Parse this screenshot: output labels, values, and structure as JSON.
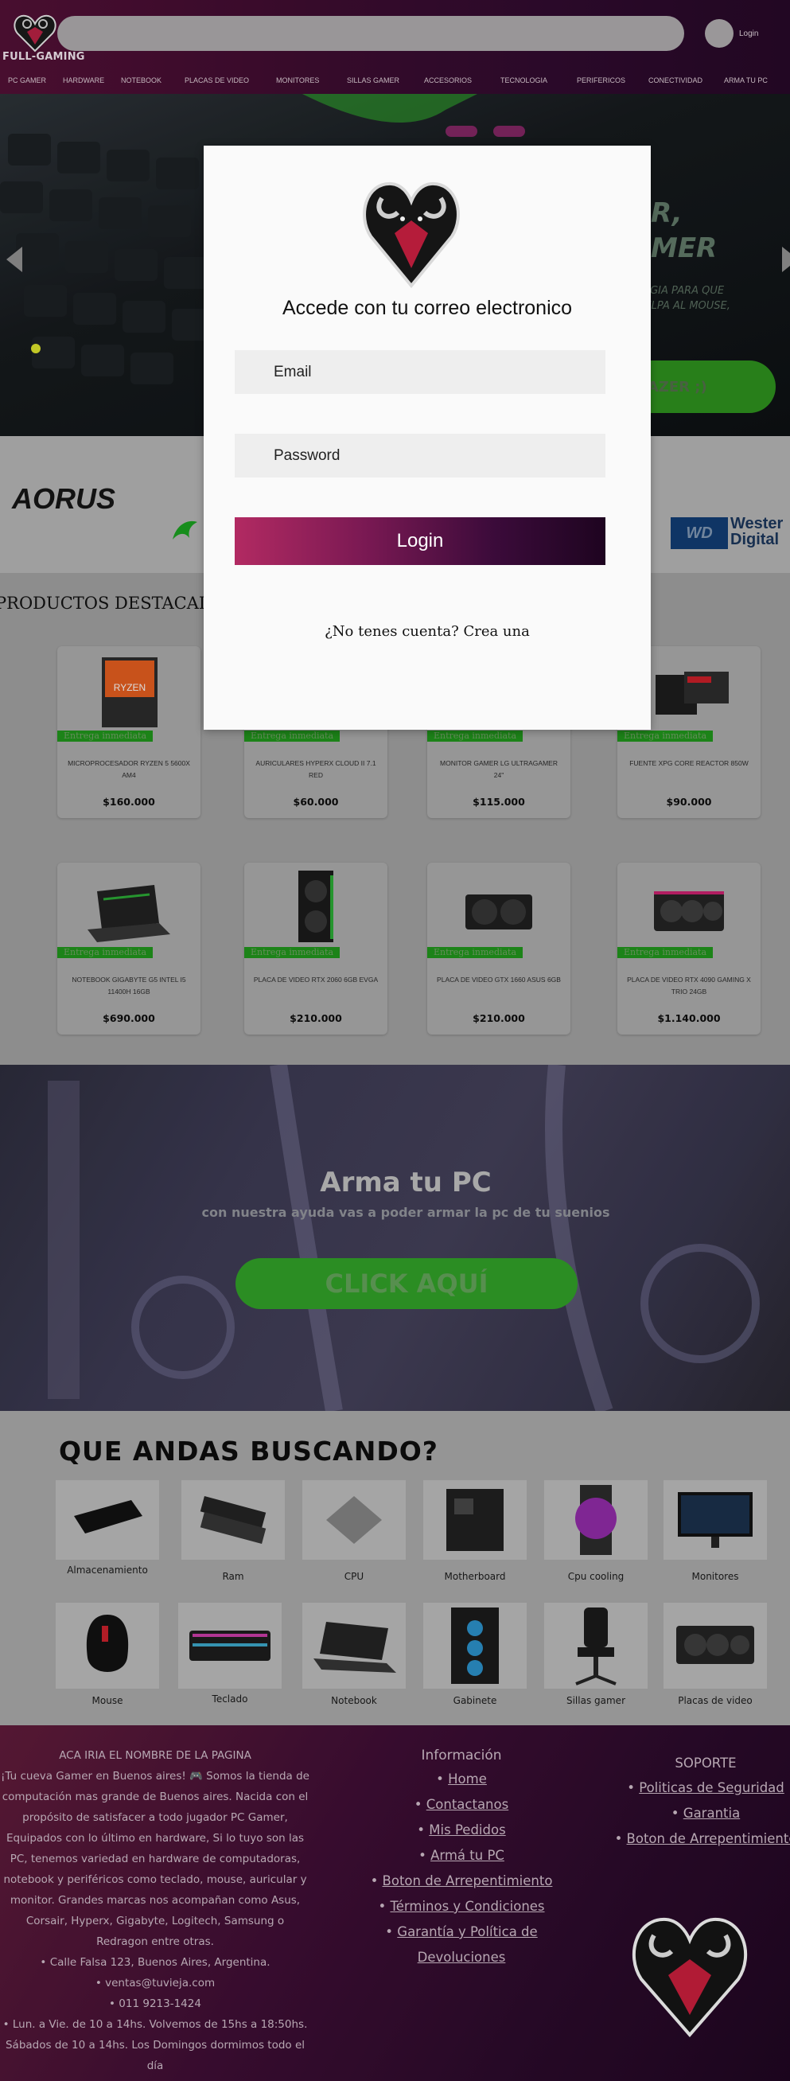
{
  "header": {
    "brand": "FULL-GAMING",
    "login": "Login",
    "nav": [
      "PC GAMER",
      "HARDWARE",
      "NOTEBOOK",
      "PLACAS DE VIDEO",
      "MONITORES",
      "SILLAS GAMER",
      "ACCESORIOS",
      "TECNOLOGIA",
      "PERIFERICOS",
      "CONECTIVIDAD",
      "ARMA TU PC"
    ]
  },
  "hero": {
    "title_line1": "R,",
    "title_line2": "MER",
    "sub_line1": "LOGIA PARA QUE",
    "sub_line2": "CULPA AL MOUSE,",
    "sub_line3": ")",
    "button": "RAZER ;)"
  },
  "brands": {
    "aorus": "AORUS",
    "wd_box": "WD",
    "wd_line1": "Wester",
    "wd_line2": "Digital"
  },
  "products": {
    "title": "PRODUCTOS DESTACADOS",
    "tag": "Entrega inmediata",
    "items": [
      {
        "name": "MICROPROCESADOR RYZEN 5 5600X AM4",
        "price": "$160.000"
      },
      {
        "name": "AURICULARES HYPERX CLOUD II 7.1 RED",
        "price": "$60.000"
      },
      {
        "name": "MONITOR GAMER LG ULTRAGAMER 24\"",
        "price": "$115.000"
      },
      {
        "name": "FUENTE XPG CORE REACTOR 850W",
        "price": "$90.000"
      },
      {
        "name": "NOTEBOOK GIGABYTE G5 INTEL I5 11400H 16GB",
        "price": "$690.000"
      },
      {
        "name": "PLACA DE VIDEO RTX 2060 6GB EVGA",
        "price": "$210.000"
      },
      {
        "name": "PLACA DE VIDEO GTX 1660 ASUS 6GB",
        "price": "$210.000"
      },
      {
        "name": "PLACA DE VIDEO RTX 4090 GAMING X TRIO 24GB",
        "price": "$1.140.000"
      }
    ]
  },
  "arma": {
    "title": "Arma tu PC",
    "subtitle": "con nuestra ayuda vas a poder armar la pc de tu suenios",
    "button": "CLICK AQUÍ"
  },
  "categories": {
    "title": "QUE ANDAS BUSCANDO?",
    "items": [
      "Almacenamiento",
      "Ram",
      "CPU",
      "Motherboard",
      "Cpu cooling",
      "Monitores",
      "Mouse",
      "Teclado",
      "Notebook",
      "Gabinete",
      "Sillas gamer",
      "Placas de video"
    ]
  },
  "footer": {
    "col1_title": "ACA IRIA EL NOMBRE DE LA PAGINA",
    "col1_desc": "¡Tu cueva Gamer en Buenos aires! 🎮 Somos la tienda de computación mas grande de Buenos aires. Nacida con el propósito de satisfacer a todo jugador PC Gamer, Equipados con lo último en hardware, Si lo tuyo son las PC, tenemos variedad en hardware de computadoras, notebook y periféricos como teclado, mouse, auricular y monitor. Grandes marcas nos acompañan como Asus, Corsair, Hyperx, Gigabyte, Logitech, Samsung o Redragon entre otras.",
    "col1_list": [
      "Calle Falsa 123, Buenos Aires, Argentina.",
      "ventas@tuvieja.com",
      "011 9213-1424",
      "Lun. a Vie. de 10 a 14hs. Volvemos de 15hs a 18:50hs. Sábados de 10 a 14hs. Los Domingos dormimos todo el día"
    ],
    "col2_title": "Información",
    "col2_links": [
      "Home",
      "Contactanos",
      "Mis Pedidos",
      "Armá tu PC",
      "Boton de Arrepentimiento",
      "Términos y Condiciones",
      "Garantía y Política de Devoluciones"
    ],
    "col3_title": "SOPORTE",
    "col3_links": [
      "Politicas de Seguridad",
      "Garantia",
      "Boton de Arrepentimiento"
    ]
  },
  "modal": {
    "title": "Accede con tu correo electronico",
    "email_placeholder": "Email",
    "password_placeholder": "Password",
    "login_button": "Login",
    "register": "¿No tenes cuenta? Crea una"
  },
  "colors": {
    "accent_green": "#2f9926",
    "footer_bg": "#3c0e32",
    "login_gradient_start": "#b22a62",
    "login_gradient_end": "#1e0420"
  },
  "icons": [
    "ram-heart-logo-icon",
    "slider-left-arrow-icon",
    "slider-right-arrow-icon",
    "razer-logo-icon",
    "user-avatar-icon"
  ]
}
